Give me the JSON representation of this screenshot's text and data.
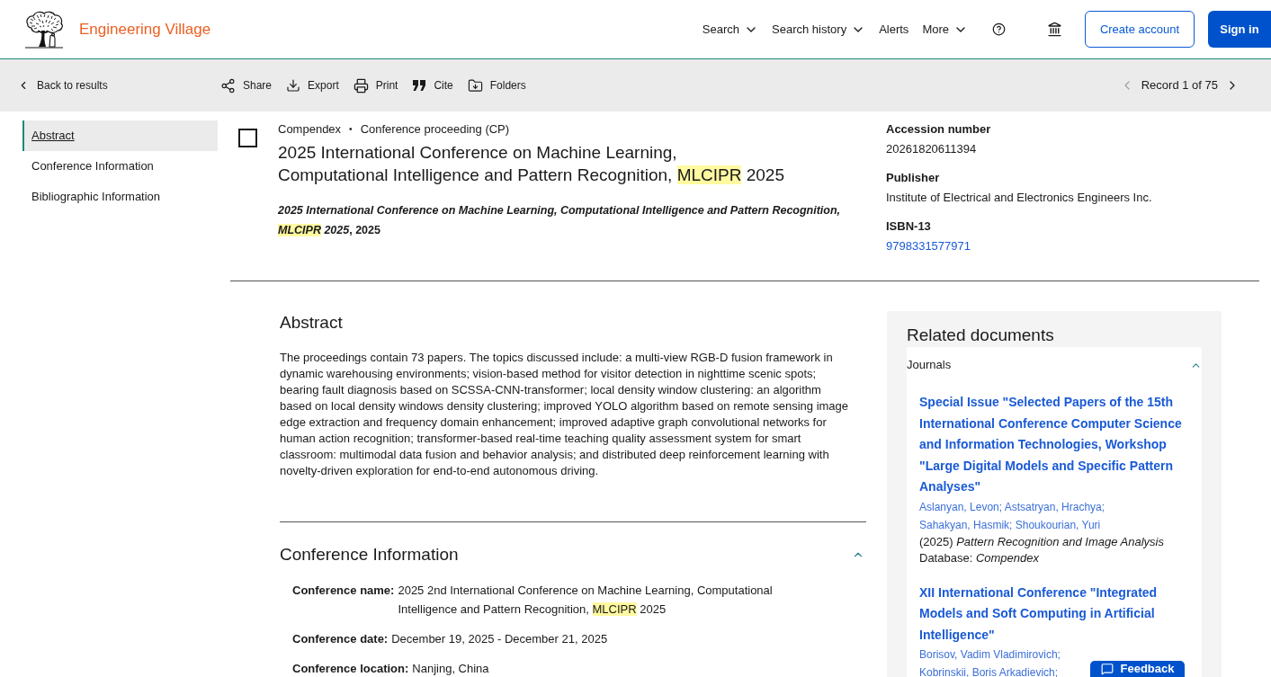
{
  "header": {
    "brand": "Engineering Village",
    "nav": [
      {
        "label": "Search",
        "dropdown": true
      },
      {
        "label": "Search history",
        "dropdown": true
      },
      {
        "label": "Alerts",
        "dropdown": false
      },
      {
        "label": "More",
        "dropdown": true
      }
    ],
    "buttons": [
      {
        "label": "Create account",
        "kind": "outline"
      },
      {
        "label": "Sign in",
        "kind": "primary"
      }
    ]
  },
  "toolbar": {
    "back": "Back to results",
    "actions": [
      {
        "label": "Share",
        "kind": "share"
      },
      {
        "label": "Export",
        "kind": "export"
      },
      {
        "label": "Print",
        "kind": "print"
      },
      {
        "label": "Cite",
        "kind": "cite"
      },
      {
        "label": "Folders",
        "kind": "folders"
      }
    ],
    "pager": {
      "label": "Record 1 of 75",
      "prev": {
        "disabled": true
      },
      "next": {
        "disabled": false
      }
    }
  },
  "side_nav": {
    "items": [
      {
        "label": "Abstract",
        "selected": true
      },
      {
        "label": "Conference Information",
        "selected": false
      },
      {
        "label": "Bibliographic Information",
        "selected": false
      }
    ]
  },
  "record": {
    "checked": false,
    "database": "Compendex",
    "separator": "•",
    "doc_type": "Conference proceeding (CP)",
    "title": [
      {
        "text": "2025 International Conference on Machine Learning, Computational Intelligence and Pattern Recognition, ",
        "highlight": false
      },
      {
        "text": "MLCIPR",
        "highlight": true
      },
      {
        "text": " 2025",
        "highlight": false
      }
    ],
    "source": [
      {
        "text": "2025 International Conference on Machine Learning, Computational Intelligence and Pattern Recognition, ",
        "italic": true,
        "highlight": false
      },
      {
        "text": "MLCIPR",
        "italic": true,
        "highlight": true
      },
      {
        "text": " 2025",
        "italic": true,
        "highlight": false
      },
      {
        "text": ", 2025",
        "italic": false,
        "highlight": false
      }
    ]
  },
  "details": [
    {
      "label": "Accession number",
      "value": "20261820611394",
      "kind": "text"
    },
    {
      "label": "Publisher",
      "value": "Institute of Electrical and Electronics Engineers Inc.",
      "kind": "text"
    },
    {
      "label": "ISBN-13",
      "value": "9798331577971",
      "kind": "link"
    }
  ],
  "abstract": {
    "heading": "Abstract",
    "text": "The proceedings contain 73 papers. The topics discussed include: a multi-view RGB-D fusion framework in dynamic warehousing environments; vision-based method for visitor detection in nighttime scenic spots; bearing fault diagnosis based on SCSSA-CNN-transformer; local density window clustering: an algorithm based on local density windows density clustering; improved YOLO algorithm based on remote sensing image edge extraction and frequency domain enhancement; improved adaptive graph convolutional networks for human action recognition; transformer-based real-time teaching quality assessment system for smart classroom: multimodal data fusion and behavior analysis; and distributed deep reinforcement learning with novelty-driven exploration for end-to-end autonomous driving."
  },
  "conference": {
    "heading": "Conference Information",
    "expanded": true,
    "fields": [
      {
        "label": "Conference name:",
        "value": [
          {
            "text": "2025 2nd International Conference on Machine Learning, Computational Intelligence and Pattern Recognition, ",
            "highlight": false
          },
          {
            "text": "MLCIPR",
            "highlight": true
          },
          {
            "text": " 2025",
            "highlight": false
          }
        ]
      },
      {
        "label": "Conference date:",
        "value": [
          {
            "text": "December 19, 2025 - December 21, 2025",
            "highlight": false
          }
        ]
      },
      {
        "label": "Conference location:",
        "value": [
          {
            "text": "Nanjing, China",
            "highlight": false
          }
        ]
      }
    ]
  },
  "related": {
    "heading": "Related documents",
    "groups": [
      {
        "label": "Journals",
        "expanded": true,
        "items": [
          {
            "title": "Special Issue \"Selected Papers of the 15th International Conference Computer Science and Information Technologies, Workshop \"Large Digital Models and Specific Pattern Analyses\"",
            "authors": [
              "Aslanyan, Levon;",
              "Astsatryan, Hrachya;",
              "Sahakyan, Hasmik;",
              "Shoukourian, Yuri"
            ],
            "citation": "(2025) *Pattern Recognition and Image Analysis*",
            "database": "Database: *Compendex*"
          },
          {
            "title": "XII International Conference \"Integrated Models and Soft Computing in Artificial Intelligence\"",
            "authors": [
              "Borisov, Vadim Vladimirovich;",
              "Kobrinskii, Boris Arkadievich;"
            ]
          }
        ]
      }
    ]
  },
  "feedback": {
    "label": "Feedback"
  }
}
